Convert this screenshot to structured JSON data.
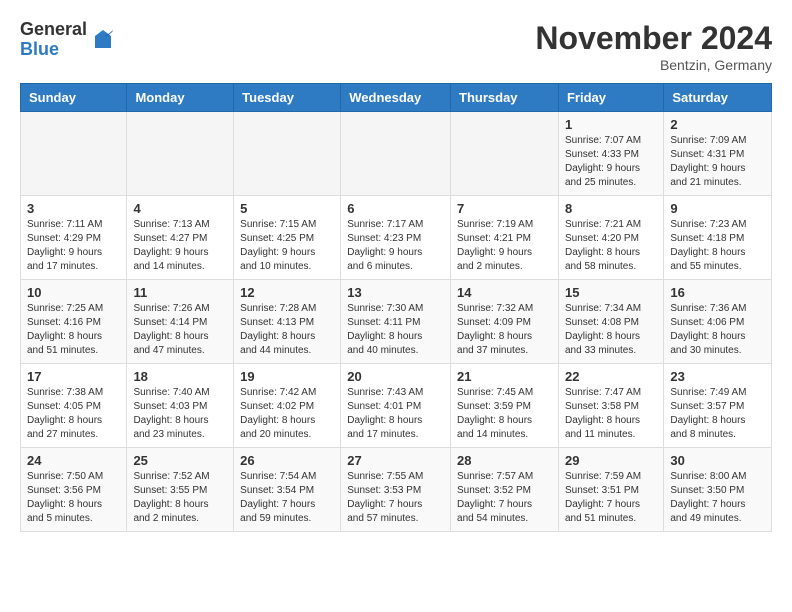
{
  "logo": {
    "general": "General",
    "blue": "Blue"
  },
  "title": "November 2024",
  "location": "Bentzin, Germany",
  "days_of_week": [
    "Sunday",
    "Monday",
    "Tuesday",
    "Wednesday",
    "Thursday",
    "Friday",
    "Saturday"
  ],
  "weeks": [
    [
      {
        "day": "",
        "info": ""
      },
      {
        "day": "",
        "info": ""
      },
      {
        "day": "",
        "info": ""
      },
      {
        "day": "",
        "info": ""
      },
      {
        "day": "",
        "info": ""
      },
      {
        "day": "1",
        "info": "Sunrise: 7:07 AM\nSunset: 4:33 PM\nDaylight: 9 hours\nand 25 minutes."
      },
      {
        "day": "2",
        "info": "Sunrise: 7:09 AM\nSunset: 4:31 PM\nDaylight: 9 hours\nand 21 minutes."
      }
    ],
    [
      {
        "day": "3",
        "info": "Sunrise: 7:11 AM\nSunset: 4:29 PM\nDaylight: 9 hours\nand 17 minutes."
      },
      {
        "day": "4",
        "info": "Sunrise: 7:13 AM\nSunset: 4:27 PM\nDaylight: 9 hours\nand 14 minutes."
      },
      {
        "day": "5",
        "info": "Sunrise: 7:15 AM\nSunset: 4:25 PM\nDaylight: 9 hours\nand 10 minutes."
      },
      {
        "day": "6",
        "info": "Sunrise: 7:17 AM\nSunset: 4:23 PM\nDaylight: 9 hours\nand 6 minutes."
      },
      {
        "day": "7",
        "info": "Sunrise: 7:19 AM\nSunset: 4:21 PM\nDaylight: 9 hours\nand 2 minutes."
      },
      {
        "day": "8",
        "info": "Sunrise: 7:21 AM\nSunset: 4:20 PM\nDaylight: 8 hours\nand 58 minutes."
      },
      {
        "day": "9",
        "info": "Sunrise: 7:23 AM\nSunset: 4:18 PM\nDaylight: 8 hours\nand 55 minutes."
      }
    ],
    [
      {
        "day": "10",
        "info": "Sunrise: 7:25 AM\nSunset: 4:16 PM\nDaylight: 8 hours\nand 51 minutes."
      },
      {
        "day": "11",
        "info": "Sunrise: 7:26 AM\nSunset: 4:14 PM\nDaylight: 8 hours\nand 47 minutes."
      },
      {
        "day": "12",
        "info": "Sunrise: 7:28 AM\nSunset: 4:13 PM\nDaylight: 8 hours\nand 44 minutes."
      },
      {
        "day": "13",
        "info": "Sunrise: 7:30 AM\nSunset: 4:11 PM\nDaylight: 8 hours\nand 40 minutes."
      },
      {
        "day": "14",
        "info": "Sunrise: 7:32 AM\nSunset: 4:09 PM\nDaylight: 8 hours\nand 37 minutes."
      },
      {
        "day": "15",
        "info": "Sunrise: 7:34 AM\nSunset: 4:08 PM\nDaylight: 8 hours\nand 33 minutes."
      },
      {
        "day": "16",
        "info": "Sunrise: 7:36 AM\nSunset: 4:06 PM\nDaylight: 8 hours\nand 30 minutes."
      }
    ],
    [
      {
        "day": "17",
        "info": "Sunrise: 7:38 AM\nSunset: 4:05 PM\nDaylight: 8 hours\nand 27 minutes."
      },
      {
        "day": "18",
        "info": "Sunrise: 7:40 AM\nSunset: 4:03 PM\nDaylight: 8 hours\nand 23 minutes."
      },
      {
        "day": "19",
        "info": "Sunrise: 7:42 AM\nSunset: 4:02 PM\nDaylight: 8 hours\nand 20 minutes."
      },
      {
        "day": "20",
        "info": "Sunrise: 7:43 AM\nSunset: 4:01 PM\nDaylight: 8 hours\nand 17 minutes."
      },
      {
        "day": "21",
        "info": "Sunrise: 7:45 AM\nSunset: 3:59 PM\nDaylight: 8 hours\nand 14 minutes."
      },
      {
        "day": "22",
        "info": "Sunrise: 7:47 AM\nSunset: 3:58 PM\nDaylight: 8 hours\nand 11 minutes."
      },
      {
        "day": "23",
        "info": "Sunrise: 7:49 AM\nSunset: 3:57 PM\nDaylight: 8 hours\nand 8 minutes."
      }
    ],
    [
      {
        "day": "24",
        "info": "Sunrise: 7:50 AM\nSunset: 3:56 PM\nDaylight: 8 hours\nand 5 minutes."
      },
      {
        "day": "25",
        "info": "Sunrise: 7:52 AM\nSunset: 3:55 PM\nDaylight: 8 hours\nand 2 minutes."
      },
      {
        "day": "26",
        "info": "Sunrise: 7:54 AM\nSunset: 3:54 PM\nDaylight: 7 hours\nand 59 minutes."
      },
      {
        "day": "27",
        "info": "Sunrise: 7:55 AM\nSunset: 3:53 PM\nDaylight: 7 hours\nand 57 minutes."
      },
      {
        "day": "28",
        "info": "Sunrise: 7:57 AM\nSunset: 3:52 PM\nDaylight: 7 hours\nand 54 minutes."
      },
      {
        "day": "29",
        "info": "Sunrise: 7:59 AM\nSunset: 3:51 PM\nDaylight: 7 hours\nand 51 minutes."
      },
      {
        "day": "30",
        "info": "Sunrise: 8:00 AM\nSunset: 3:50 PM\nDaylight: 7 hours\nand 49 minutes."
      }
    ]
  ]
}
